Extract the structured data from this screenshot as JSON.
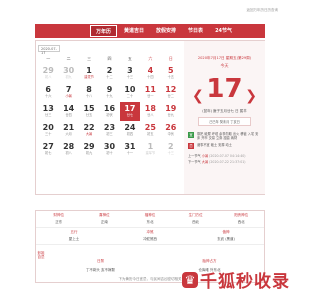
{
  "topnote": "返回万年历日历查询",
  "tabs": [
    "万年历",
    "黄道吉日",
    "放假安排",
    "节日表",
    "24节气"
  ],
  "calendar": {
    "date_value": "2020-07-17",
    "prev_btn": "<",
    "next_btn": ">",
    "weekdays": [
      "一",
      "二",
      "三",
      "四",
      "五",
      "六",
      "日"
    ],
    "cells": [
      {
        "d": "29",
        "l": "初八",
        "cls": "other"
      },
      {
        "d": "30",
        "l": "初九",
        "cls": "other"
      },
      {
        "d": "1",
        "l": "建党节",
        "cls": "",
        "fest": true
      },
      {
        "d": "2",
        "l": "十二",
        "cls": ""
      },
      {
        "d": "3",
        "l": "十三",
        "cls": ""
      },
      {
        "d": "4",
        "l": "十四",
        "cls": "we"
      },
      {
        "d": "5",
        "l": "十五",
        "cls": "we"
      },
      {
        "d": "6",
        "l": "十六",
        "cls": ""
      },
      {
        "d": "7",
        "l": "小暑",
        "cls": "",
        "fest": true
      },
      {
        "d": "8",
        "l": "十八",
        "cls": ""
      },
      {
        "d": "9",
        "l": "十九",
        "cls": ""
      },
      {
        "d": "10",
        "l": "二十",
        "cls": ""
      },
      {
        "d": "11",
        "l": "廿一",
        "cls": "we"
      },
      {
        "d": "12",
        "l": "廿二",
        "cls": "we"
      },
      {
        "d": "13",
        "l": "廿三",
        "cls": ""
      },
      {
        "d": "14",
        "l": "廿四",
        "cls": ""
      },
      {
        "d": "15",
        "l": "廿五",
        "cls": ""
      },
      {
        "d": "16",
        "l": "初伏",
        "cls": ""
      },
      {
        "d": "17",
        "l": "廿七",
        "cls": "today"
      },
      {
        "d": "18",
        "l": "廿八",
        "cls": "we"
      },
      {
        "d": "19",
        "l": "廿九",
        "cls": "we"
      },
      {
        "d": "20",
        "l": "三十",
        "cls": ""
      },
      {
        "d": "21",
        "l": "六月",
        "cls": ""
      },
      {
        "d": "22",
        "l": "大暑",
        "cls": "",
        "fest": true
      },
      {
        "d": "23",
        "l": "初三",
        "cls": ""
      },
      {
        "d": "24",
        "l": "初四",
        "cls": ""
      },
      {
        "d": "25",
        "l": "初五",
        "cls": "we"
      },
      {
        "d": "26",
        "l": "中伏",
        "cls": "we"
      },
      {
        "d": "27",
        "l": "初七",
        "cls": ""
      },
      {
        "d": "28",
        "l": "初八",
        "cls": ""
      },
      {
        "d": "29",
        "l": "初九",
        "cls": ""
      },
      {
        "d": "30",
        "l": "初十",
        "cls": ""
      },
      {
        "d": "31",
        "l": "十一",
        "cls": ""
      },
      {
        "d": "1",
        "l": "建军节",
        "cls": "other"
      },
      {
        "d": "2",
        "l": "十三",
        "cls": "other"
      }
    ]
  },
  "right": {
    "date": "2020年7月17日 星期五(第29周)",
    "week_label": "今天",
    "big_day": "17",
    "lunar": "(鼠年) 庚子五月廿七 日 属羊",
    "ganzhi": "己巳年 癸未月 丁亥日",
    "yi_label": "宜",
    "yi_text": "祭祀 破屋 坏垣 余事勿取 出火 移徙 入宅 安床 开市 交易 立券 挂匾 纳财",
    "ji_label": "忌",
    "ji_text": "诸事不宜 破土 安葬 动土",
    "jq_prev_label": "上一节气",
    "jq_prev_name": "小暑",
    "jq_prev_time": "(2020-07-07 04:14:40)",
    "jq_next_label": "下一节气",
    "jq_next_name": "大暑",
    "jq_next_time": "(2020-07-22 21:37:01)"
  },
  "bottom": {
    "row1": [
      {
        "k": "财神位",
        "v": "正东"
      },
      {
        "k": "喜神位",
        "v": "正南"
      },
      {
        "k": "福神位",
        "v": "东北"
      },
      {
        "k": "生门方位",
        "v": "西北"
      },
      {
        "k": "阳贵神位",
        "v": "西北"
      }
    ],
    "row2": [
      {
        "k": "五行",
        "v": "屋上土"
      },
      {
        "k": "冲煞",
        "v": "冲蛇煞西"
      },
      {
        "k": "值神",
        "v": "玄武 (黑道)"
      }
    ],
    "side_label": "彭祖百忌",
    "row3": [
      {
        "k": "日禁",
        "v": "丁不剃头 亥不嫁娶"
      }
    ],
    "taboo": "胎神占方",
    "taboo_v": "仓库碓 外东北",
    "footnote": "下为黄历今日宜忌，与民间吉凶密切相关"
  },
  "watermark": "千狐秒收录"
}
